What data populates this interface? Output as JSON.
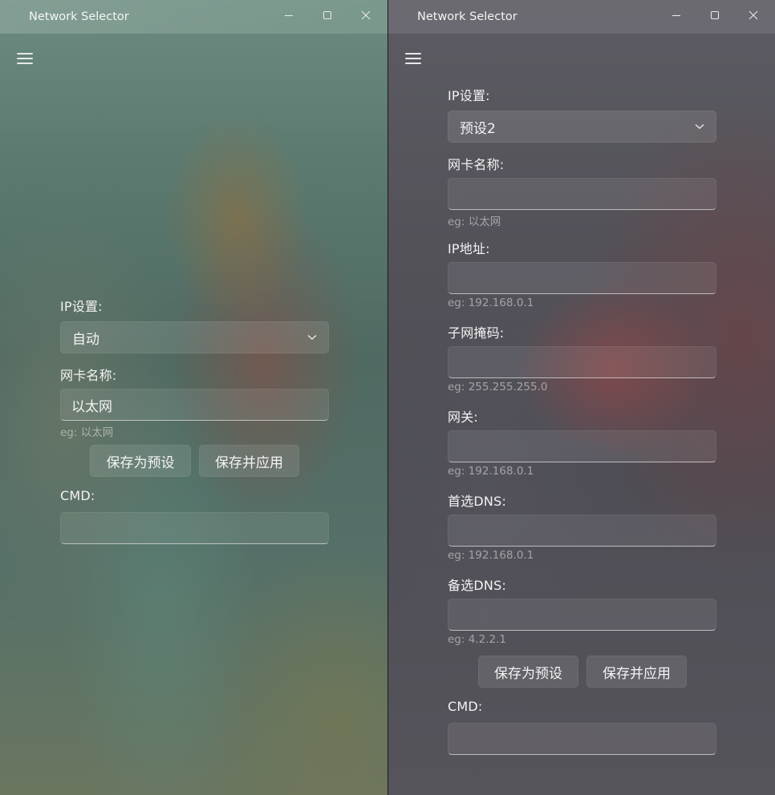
{
  "left_window": {
    "title": "Network Selector",
    "ip_settings": {
      "label": "IP设置:",
      "selected": "自动"
    },
    "adapter": {
      "label": "网卡名称:",
      "value": "以太网",
      "hint": "eg: 以太网"
    },
    "buttons": {
      "save_preset": "保存为预设",
      "save_apply": "保存并应用"
    },
    "cmd": {
      "label": "CMD:",
      "value": ""
    }
  },
  "right_window": {
    "title": "Network Selector",
    "ip_settings": {
      "label": "IP设置:",
      "selected": "预设2"
    },
    "adapter": {
      "label": "网卡名称:",
      "value": "",
      "hint": "eg: 以太网"
    },
    "ip_address": {
      "label": "IP地址:",
      "value": "",
      "hint": "eg: 192.168.0.1"
    },
    "subnet_mask": {
      "label": "子网掩码:",
      "value": "",
      "hint": "eg: 255.255.255.0"
    },
    "gateway": {
      "label": "网关:",
      "value": "",
      "hint": "eg: 192.168.0.1"
    },
    "primary_dns": {
      "label": "首选DNS:",
      "value": "",
      "hint": "eg: 192.168.0.1"
    },
    "secondary_dns": {
      "label": "备选DNS:",
      "value": "",
      "hint": "eg: 4.2.2.1"
    },
    "buttons": {
      "save_preset": "保存为预设",
      "save_apply": "保存并应用"
    },
    "cmd": {
      "label": "CMD:",
      "value": ""
    }
  },
  "icons": {
    "menu": "hamburger-menu-icon",
    "minimize": "minimize-icon",
    "maximize": "maximize-icon",
    "close": "close-icon",
    "dropdown": "chevron-down-icon"
  }
}
